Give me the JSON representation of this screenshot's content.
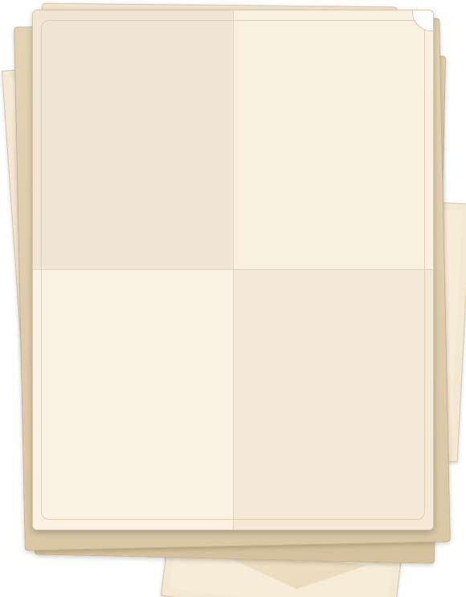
{
  "scene": {
    "letter_fold_panels": [
      "top-left",
      "top-right",
      "bottom-left",
      "bottom-right"
    ],
    "colors": {
      "paper": "#f9eee0",
      "kraft": "#d9c7a5",
      "airmail_red": "#cc3b3b",
      "airmail_blue": "#2f5f9e",
      "envelope": "#f3e8d2"
    }
  }
}
